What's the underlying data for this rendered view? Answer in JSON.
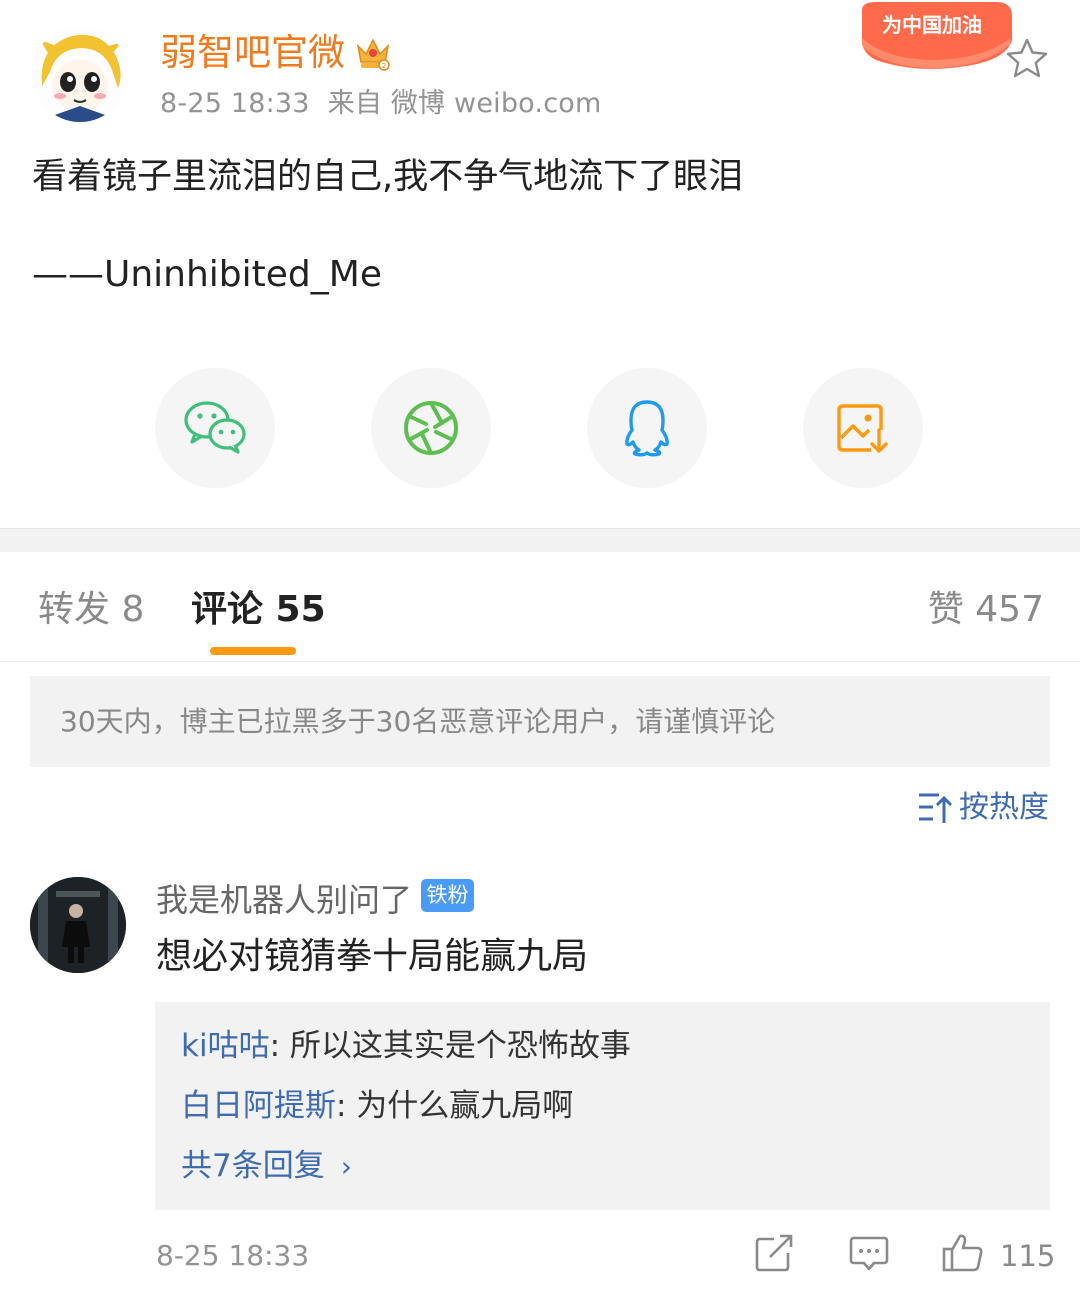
{
  "post": {
    "author": "弱智吧官微",
    "time": "8-25 18:33",
    "source": "来自 微博 weibo.com",
    "badge_text": "为中国加油",
    "text": "看着镜子里流泪的自己,我不争气地流下了眼泪",
    "signature": "——Uninhibited_Me",
    "icons": {
      "crown": "vip-crown-icon",
      "favorite": "star-icon"
    }
  },
  "share": [
    {
      "name": "wechat",
      "icon": "wechat-icon",
      "color": "#3fc07a"
    },
    {
      "name": "moments",
      "icon": "aperture-icon",
      "color": "#5cbf50"
    },
    {
      "name": "qq",
      "icon": "qq-penguin-icon",
      "color": "#1e9bf0"
    },
    {
      "name": "save-image",
      "icon": "image-download-icon",
      "color": "#ff9812"
    }
  ],
  "tabs": {
    "repost": "转发 8",
    "comment": "评论 55",
    "like": "赞 457"
  },
  "notice": "30天内，博主已拉黑多于30名恶意评论用户，请谨慎评论",
  "sort_label": "按热度",
  "comment": {
    "user": "我是机器人别问了",
    "fan_badge": "铁粉",
    "text": "想必对镜猜拳十局能赢九局",
    "replies": [
      {
        "user": "ki咕咕",
        "text": ": 所以这其实是个恐怖故事"
      },
      {
        "user": "白日阿提斯",
        "text": ": 为什么赢九局啊"
      }
    ],
    "more_replies": "共7条回复",
    "time": "8-25 18:33",
    "likes": "115"
  },
  "colors": {
    "accent": "#ff9812",
    "username": "#f07a1e",
    "link": "#3f6cb0",
    "badge_blue": "#4a9bf6"
  }
}
